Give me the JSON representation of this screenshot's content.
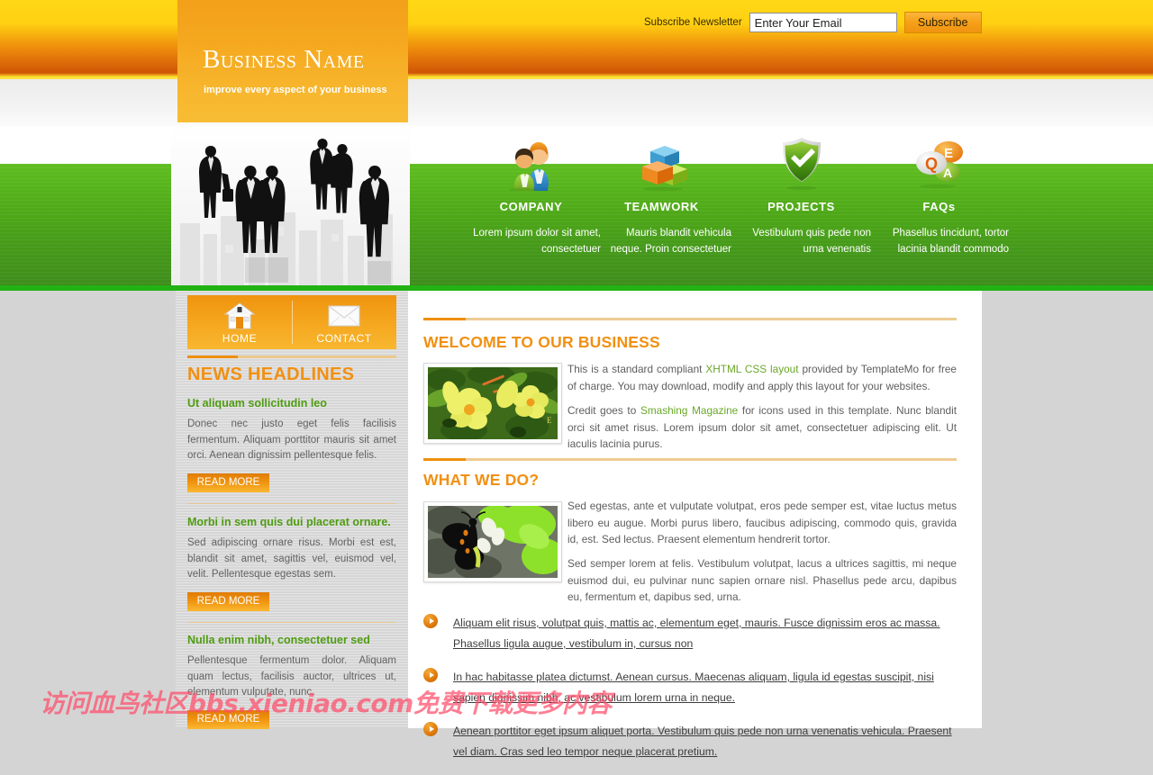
{
  "header": {
    "logo_title": "Business Name",
    "logo_tagline": "improve every aspect of your business",
    "newsletter_label": "Subscribe Newsletter",
    "newsletter_placeholder": "Enter Your Email",
    "newsletter_value": "Enter Your Email",
    "subscribe_button": "Subscribe"
  },
  "features": [
    {
      "icon": "users-icon",
      "title": "COMPANY",
      "desc": "Lorem ipsum dolor sit amet, consectetuer"
    },
    {
      "icon": "boxes-icon",
      "title": "TEAMWORK",
      "desc": "Mauris blandit vehicula neque. Proin consectetuer"
    },
    {
      "icon": "shield-check-icon",
      "title": "PROJECTS",
      "desc": "Vestibulum quis pede non urna venenatis"
    },
    {
      "icon": "qa-bubbles-icon",
      "title": "FAQs",
      "desc": "Phasellus tincidunt, tortor lacinia blandit commodo"
    }
  ],
  "sidebar": {
    "tabs": [
      {
        "label": "HOME",
        "icon": "house-icon",
        "active": true
      },
      {
        "label": "CONTACT",
        "icon": "envelope-icon",
        "active": false
      }
    ],
    "news_title": "NEWS HEADLINES",
    "read_more": "READ MORE",
    "news": [
      {
        "heading": "Ut aliquam sollicitudin leo",
        "body": "Donec nec justo eget felis facilisis fermentum. Aliquam porttitor mauris sit amet orci. Aenean dignissim pellentesque felis."
      },
      {
        "heading": "Morbi in sem quis dui placerat ornare.",
        "body": "Sed adipiscing ornare risus. Morbi est est, blandit sit amet, sagittis vel, euismod vel, velit. Pellentesque egestas sem."
      },
      {
        "heading": "Nulla enim nibh, consectetuer sed",
        "body": "Pellentesque fermentum dolor. Aliquam quam lectus, facilisis auctor, ultrices ut, elementum vulputate, nunc."
      }
    ]
  },
  "main": {
    "welcome": {
      "title": "WELCOME TO OUR BUSINESS",
      "image_alt": "yellow-flowers-photo",
      "p1_a": "This is a standard compliant ",
      "p1_link": "XHTML CSS layout",
      "p1_b": " provided by TemplateMo for free of charge. You may download, modify and apply this layout for your websites.",
      "p2_a": "Credit goes to ",
      "p2_link": "Smashing Magazine",
      "p2_b": " for icons used in this template. Nunc blandit orci sit amet risus. Lorem ipsum dolor sit amet, consectetuer adipiscing elit. Ut iaculis lacinia purus."
    },
    "whatwedo": {
      "title": "WHAT WE DO?",
      "image_alt": "butterfly-photo",
      "p1": "Sed egestas, ante et vulputate volutpat, eros pede semper est, vitae luctus metus libero eu augue. Morbi purus libero, faucibus adipiscing, commodo quis, gravida id, est. Sed lectus. Praesent elementum hendrerit tortor.",
      "p2": "Sed semper lorem at felis. Vestibulum volutpat, lacus a ultrices sagittis, mi neque euismod dui, eu pulvinar nunc sapien ornare nisl. Phasellus pede arcu, dapibus eu, fermentum et, dapibus sed, urna."
    },
    "bullets": [
      "Aliquam elit risus, volutpat quis, mattis ac, elementum eget, mauris. Fusce dignissim eros ac massa. Phasellus ligula augue, vestibulum in, cursus non",
      "In hac habitasse platea dictumst. Aenean cursus. Maecenas aliquam, ligula id egestas suscipit, nisi sapien dignissim nibh, ac vestibulum lorem urna in neque.",
      "Aenean porttitor eget ipsum aliquet porta. Vestibulum quis pede non urna venenatis vehicula. Praesent vel diam. Cras sed leo tempor neque placerat pretium."
    ]
  },
  "watermark": {
    "text": "访问血鸟社区bbs.xieniao.com免费下载更多内容"
  },
  "colors": {
    "orange": "#f19012",
    "green": "#4f9c12",
    "green_bar": "#4ca617",
    "green_stripe": "#22b214",
    "link_green": "#6aa828",
    "body_text": "#5e5e5e"
  }
}
